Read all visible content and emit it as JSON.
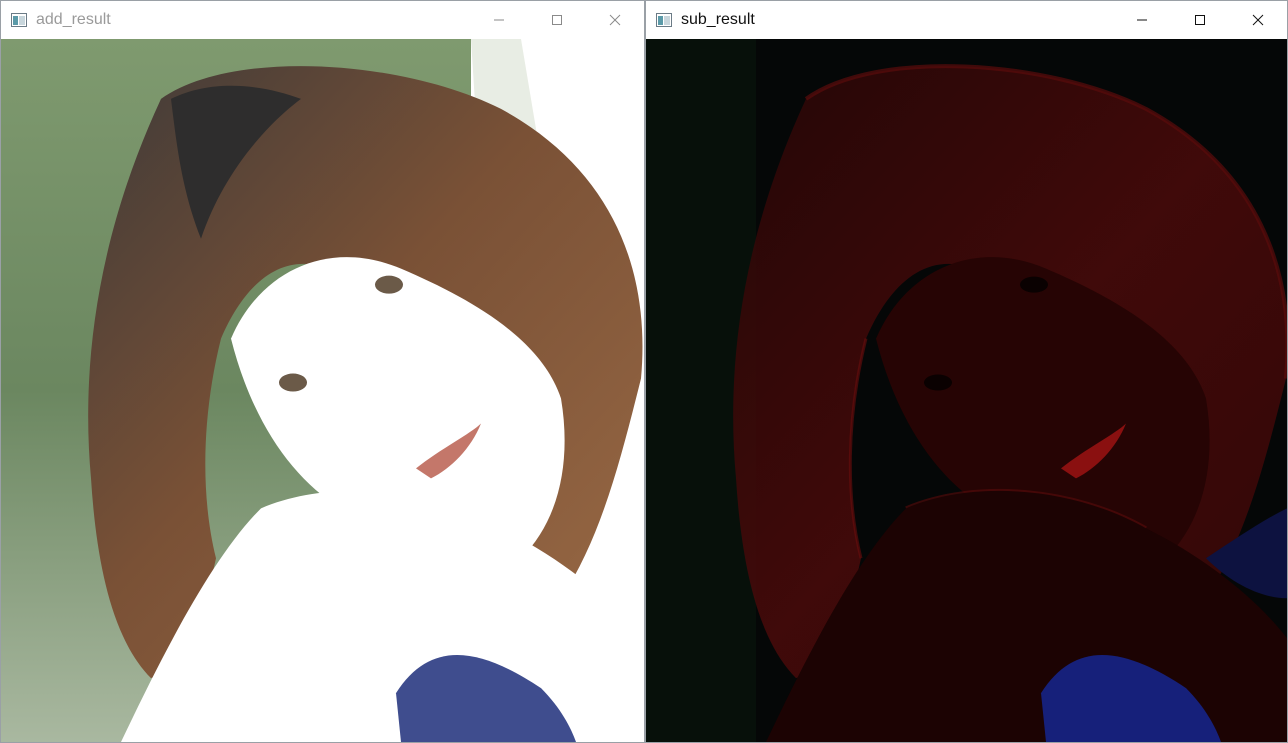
{
  "windows": [
    {
      "title": "add_result",
      "state": "inactive",
      "icon": "opencv-window-icon",
      "controls": [
        "minimize-icon",
        "maximize-icon",
        "close-icon"
      ]
    },
    {
      "title": "sub_result",
      "state": "active",
      "icon": "opencv-window-icon",
      "controls": [
        "minimize-icon",
        "maximize-icon",
        "close-icon"
      ]
    }
  ],
  "colors": {
    "add_background": "#6f8a62",
    "add_skin": "#ffffff",
    "add_hair": "#6a4a35",
    "add_collar": "#3f4d8e",
    "sub_background": "#050707",
    "sub_hair_edges": "#5a0c0c",
    "sub_collar": "#16207a",
    "titlebar_inactive_text": "#9a9a9a",
    "titlebar_active_text": "#111111"
  }
}
